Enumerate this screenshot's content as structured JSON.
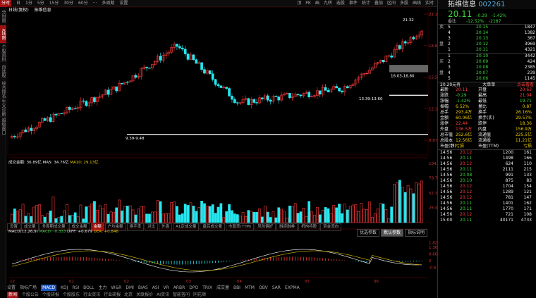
{
  "left_tabs": [
    "分时图",
    "K线图",
    "个股资料",
    "自选股",
    "综合排名",
    "牛叉诊断",
    "超级盘口"
  ],
  "top_tabs": [
    "分时",
    "日",
    "1分",
    "5分",
    "15分",
    "30分",
    "60分",
    "···",
    "多周期",
    "设置"
  ],
  "toolbar": [
    "顶",
    "PK",
    "画",
    "九转",
    "选股",
    "事件",
    "统计",
    "叠加",
    "区间",
    "多股",
    "画线",
    "实时"
  ],
  "sub_label": {
    "period": "日线(复权)",
    "stock": "拓维信息"
  },
  "main_annotations": {
    "high": "21.32",
    "range1": "16.03-16.80",
    "range2": "13.39-13.60",
    "range3": "9.39-9.48"
  },
  "axis_labels": {
    "price": [
      "22.15",
      "18.83",
      "15.51",
      "12.19",
      "8.87"
    ],
    "volume": [
      "104.6",
      "78.77",
      "52.30",
      "26.47"
    ],
    "macd": [
      "1.82",
      "1.36",
      "0.664",
      "0",
      "-0.677"
    ],
    "dates": [
      "12",
      "01",
      "02",
      "03",
      "04",
      "05",
      "06"
    ]
  },
  "vol_info": {
    "amount": "成交金额: 36.89亿",
    "ma5": "MA5: 34.76亿",
    "ma10": "MA10: 29.13亿"
  },
  "ind_tabs": [
    "设置",
    "成交量",
    "多周期成交量",
    "成交金额",
    "金额",
    "户均金额",
    "换手率",
    "对比",
    "外盘",
    "A1定成交量",
    "盘后成交量",
    "市盈率(TTM)",
    "风险偏好",
    "融资融券",
    "机构持股",
    "资金流向"
  ],
  "param_tabs": [
    "优选参数",
    "默认参数",
    "指标说明"
  ],
  "macd_info": {
    "name": "MACD(12,26,9)",
    "macd": "MACD: -0.333",
    "diff": "DIFF: +0.679",
    "dea": "DEA: +0.846"
  },
  "btm_tabs": [
    "设置",
    "指标广场",
    "MACD",
    "KDJ",
    "RSI",
    "BOLL",
    "主力",
    "W&R",
    "DMI",
    "BIAS",
    "ASI",
    "VR",
    "ARBR",
    "DPO",
    "TRIX",
    "成交量",
    "BBI",
    "MTM",
    "OBV",
    "SAR",
    "EXPMA"
  ],
  "btm_row": [
    "新闻",
    "个股公告",
    "个股研报",
    "个股股东",
    "行业资讯",
    "行业研报",
    "北京",
    "关联报价",
    "AI资讯",
    "智能答问",
    "同花顺"
  ],
  "quote": {
    "name": "拓维信息",
    "code": "002261",
    "price": "20.11",
    "change": "-0.29",
    "pct": "-1.42%",
    "weibi_label": "委比",
    "weibi": "-12.52%",
    "weicha": "-2187",
    "asks": [
      [
        "5",
        "20.15",
        "1847"
      ],
      [
        "4",
        "20.14",
        "1382"
      ],
      [
        "3",
        "20.13",
        "367"
      ],
      [
        "2",
        "20.12",
        "3969"
      ],
      [
        "1",
        "20.11",
        "4321"
      ]
    ],
    "bids": [
      [
        "1",
        "20.10",
        "3442"
      ],
      [
        "2",
        "20.09",
        "424"
      ],
      [
        "3",
        "20.08",
        "2385"
      ],
      [
        "4",
        "20.07",
        "239"
      ],
      [
        "5",
        "20.06",
        "1145"
      ]
    ],
    "side_labels": {
      "sell": "卖",
      "buy": "买",
      "pan": "盘"
    },
    "big": {
      "left": "20.20元有",
      "mid": "大单单",
      "right": "点击看看"
    },
    "stats": [
      [
        "最新",
        "20.11",
        "开盘",
        "20.63"
      ],
      [
        "涨跌",
        "-0.29",
        "最高",
        "21.04"
      ],
      [
        "涨幅",
        "-1.42%",
        "最低",
        "19.71"
      ],
      [
        "振幅",
        "6.52%",
        "量比",
        "0.87"
      ],
      [
        "总手",
        "293.4万",
        "换手",
        "26.16%"
      ],
      [
        "金额",
        "60.06亿",
        "换手(实)",
        "29.57%"
      ],
      [
        "涨停",
        "22.44",
        "跌停",
        "18.36"
      ],
      [
        "外盘",
        "136.5万",
        "内盘",
        "156.9万"
      ],
      [
        "总市值",
        "252.6亿",
        "流通值",
        "225.5亿"
      ],
      [
        "总股本",
        "12.56亿",
        "流通股",
        "11.21亿"
      ],
      [
        "市盈(静)",
        "亏损",
        "市盈(TTM)",
        "亏损"
      ]
    ],
    "ticks": [
      [
        "14:56",
        "20.12",
        "1200",
        "161"
      ],
      [
        "14:56",
        "20.11",
        "1498",
        "166"
      ],
      [
        "14:56",
        "20.12",
        "624",
        "110"
      ],
      [
        "14:56",
        "20.11",
        "2111",
        "215"
      ],
      [
        "14:56",
        "20.08",
        "991",
        "133"
      ],
      [
        "14:56",
        "20.10",
        "875",
        "83"
      ],
      [
        "14:56",
        "20.12",
        "1704",
        "154"
      ],
      [
        "14:56",
        "20.12",
        "1289",
        "121"
      ],
      [
        "14:56",
        "20.12",
        "781",
        "147"
      ],
      [
        "14:56",
        "20.11",
        "1401",
        "162"
      ],
      [
        "14:56",
        "20.11",
        "1770",
        "171"
      ],
      [
        "14:56",
        "20.12",
        "721",
        "108"
      ],
      [
        "15:00",
        "20.11",
        "40171",
        "4733"
      ]
    ]
  },
  "colors": {
    "up": "#ff3b3b",
    "down": "#25e8f0",
    "ma5": "#ffffff",
    "ma10": "#e8c800",
    "accent": "#a01010"
  }
}
